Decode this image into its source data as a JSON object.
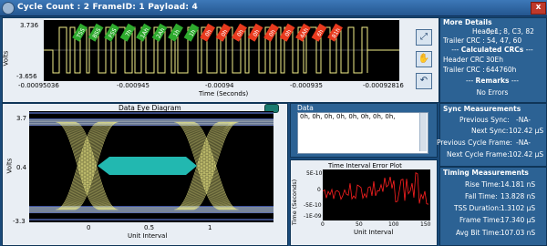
{
  "window": {
    "title": "Cycle Count : 2   FrameID: 1   Payload: 4",
    "close_label": "x"
  },
  "timeline": {
    "y_max": "3.736",
    "y_min": "-3.656",
    "y_label": "Volts",
    "x_label": "Time (Seconds)",
    "x_ticks": [
      "-0.00095036",
      "-0.000945",
      "-0.00094",
      "-0.000935",
      "-0.00093",
      "-0.00092816"
    ],
    "decode_labels": [
      "TSS",
      "BSS",
      "FSS",
      "7h",
      "1Ah",
      "2Ah",
      "1h",
      "1h",
      "0h",
      "0h",
      "0h",
      "0h",
      "0h",
      "0h",
      "4Ah",
      "6h",
      "81h"
    ]
  },
  "eye_diagram": {
    "title": "Data Eye Diagram",
    "y_label": "Volts",
    "x_label": "Unit Interval",
    "y_ticks": [
      "3.7",
      "0.4",
      "-3.3"
    ],
    "x_ticks": [
      "0",
      "0.5",
      "1"
    ]
  },
  "data_box": {
    "label": "Data",
    "content": "0h, 0h, 0h, 0h, 0h, 0h, 0h, 0h,"
  },
  "tie_plot": {
    "title": "Time Interval Error Plot",
    "y_label": "Time (Seconds)",
    "x_label": "Unit Interval",
    "y_ticks": [
      "5E-10",
      "0",
      "-5E-10",
      "-1E-09"
    ],
    "x_ticks": [
      "0",
      "50",
      "100",
      "150"
    ]
  },
  "more_details": {
    "title": "More Details",
    "header_label": "Header :",
    "header_value": "0, 1, 8, C3, 82",
    "trailer_label": "Trailer CRC :",
    "trailer_value": "54, 47, 60",
    "calc_crc_title": "Calculated CRCs",
    "header_crc_label": "Header CRC :",
    "header_crc_value": "30Eh",
    "trailer_crc_label": "Trailer CRC :",
    "trailer_crc_value": "644760h",
    "remarks_title": "Remarks",
    "remarks_value": "No Errors"
  },
  "sync": {
    "title": "Sync Measurements",
    "rows": [
      {
        "label": "Previous Sync:",
        "value": "-NA-"
      },
      {
        "label": "Next Sync:",
        "value": "102.42 µS"
      },
      {
        "label": "Previous Cycle Frame:",
        "value": "-NA-"
      },
      {
        "label": "Next Cycle Frame:",
        "value": "102.42 µS"
      }
    ]
  },
  "timing": {
    "title": "Timing Measurements",
    "rows": [
      {
        "label": "Rise Time:",
        "value": "14.181 nS"
      },
      {
        "label": "Fall Time:",
        "value": "13.828 nS"
      },
      {
        "label": "TSS Duration:",
        "value": "1.3102 µS"
      },
      {
        "label": "Frame Time:",
        "value": "17.340 µS"
      },
      {
        "label": "Avg Bit Time:",
        "value": "107.03 nS"
      }
    ]
  },
  "colors": {
    "background": "#1a4a7a",
    "trace": "#f4f08a",
    "eye_fill": "#22b8b0",
    "decode_green": "#2eaa2e",
    "decode_red": "#e83a1e",
    "tie_line": "#ff2020"
  },
  "icons": [
    "zoom-fit-icon",
    "hand-pan-icon",
    "undo-icon"
  ]
}
